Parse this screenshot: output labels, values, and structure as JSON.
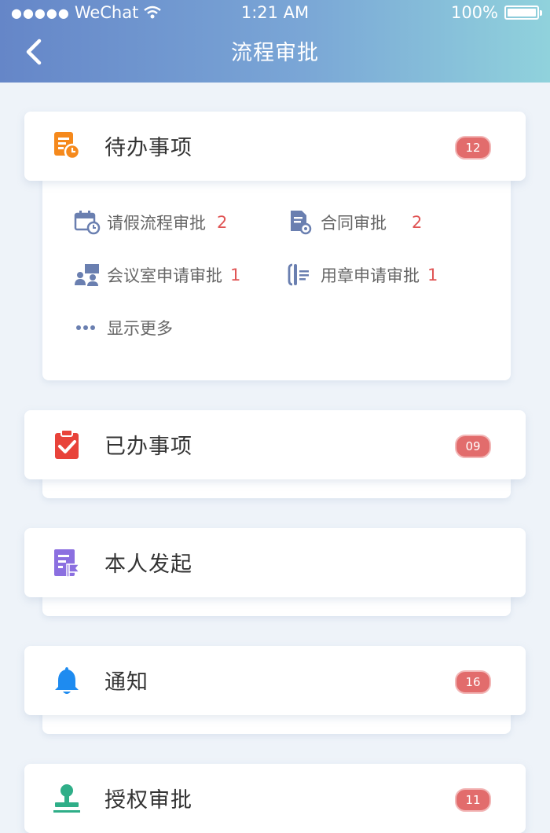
{
  "status_bar": {
    "signal": "●●●●●",
    "carrier": "WeChat",
    "time": "1:21 AM",
    "battery": "100%"
  },
  "nav": {
    "title": "流程审批"
  },
  "pending": {
    "label": "待办事项",
    "badge": "12",
    "items": [
      {
        "label": "请假流程审批",
        "count": "2"
      },
      {
        "label": "合同审批",
        "count": "2"
      },
      {
        "label": "会议室申请审批",
        "count": "1"
      },
      {
        "label": "用章申请审批",
        "count": "1"
      }
    ],
    "more": "显示更多"
  },
  "done": {
    "label": "已办事项",
    "badge": "09"
  },
  "mine": {
    "label": "本人发起"
  },
  "notice": {
    "label": "通知",
    "badge": "16"
  },
  "auth": {
    "label": "授权审批",
    "badge": "11"
  },
  "colors": {
    "header_start": "#6586c8",
    "header_end": "#90d2dc",
    "badge": "#e26c6c",
    "count": "#e05555"
  }
}
